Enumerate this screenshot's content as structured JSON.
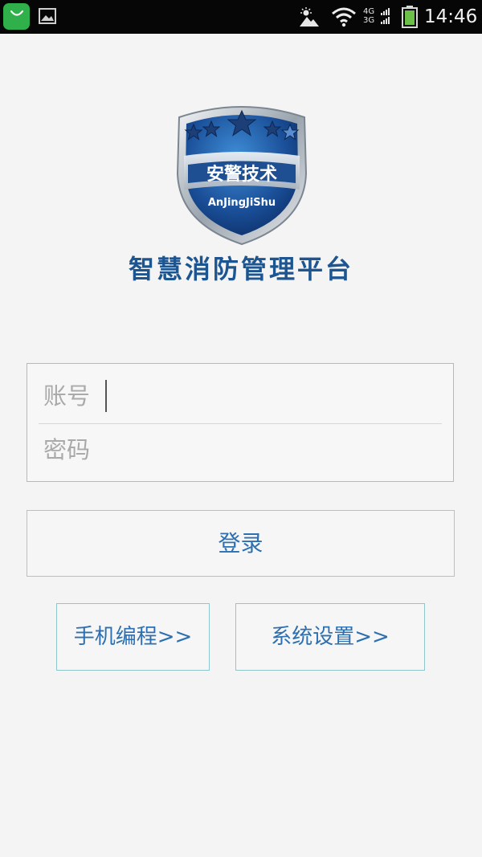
{
  "status_bar": {
    "time": "14:46",
    "network_top": "4G",
    "network_bottom": "3G",
    "icons": [
      "shopping-bag-icon",
      "gallery-icon",
      "weather-icon",
      "wifi-icon",
      "signal-icon",
      "battery-icon"
    ]
  },
  "logo": {
    "text_cn": "安警技术",
    "text_en": "AnJingJiShu"
  },
  "app_title": "智慧消防管理平台",
  "form": {
    "account_placeholder": "账号",
    "password_placeholder": "密码"
  },
  "buttons": {
    "login": "登录",
    "phone_programming": "手机编程>>",
    "system_settings": "系统设置>>"
  },
  "colors": {
    "accent": "#2d6fb0",
    "title": "#1c5590",
    "button_border": "#8fc6cc",
    "background": "#f4f4f4"
  }
}
